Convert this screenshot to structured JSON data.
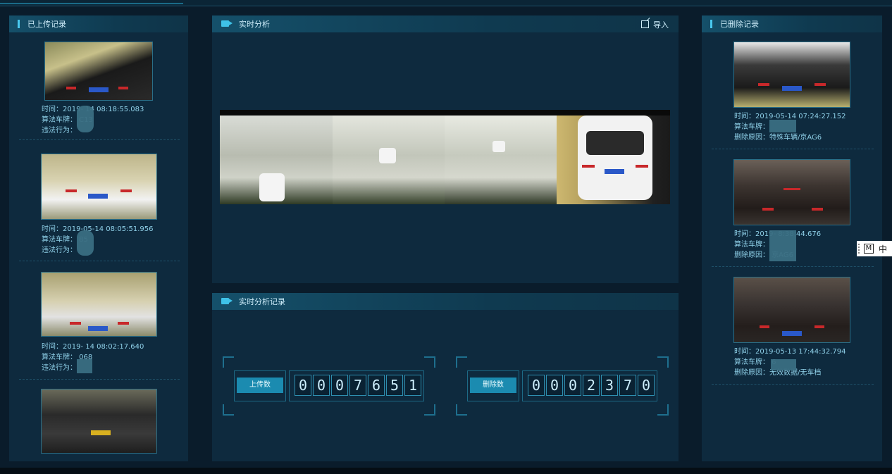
{
  "left_panel": {
    "title": "已上传记录",
    "records": [
      {
        "time": "时间：2019-  14 08:18:55.083",
        "plate": "算法车牌：  C13",
        "violation": "违法行为："
      },
      {
        "time": "时间：2019-05-14 08:05:51.956",
        "plate": "算法车牌：  85",
        "violation": "违法行为："
      },
      {
        "time": "时间：2019-  14 08:02:17.640",
        "plate": "算法车牌：  068",
        "violation": "违法行为："
      }
    ]
  },
  "center_top": {
    "title": "实时分析",
    "import_label": "导入"
  },
  "center_bottom": {
    "title": "实时分析记录",
    "upload_label": "上传数",
    "upload_digits": [
      "0",
      "0",
      "0",
      "7",
      "6",
      "5",
      "1"
    ],
    "delete_label": "删除数",
    "delete_digits": [
      "0",
      "0",
      "0",
      "2",
      "3",
      "7",
      "0"
    ]
  },
  "right_panel": {
    "title": "已删除记录",
    "records": [
      {
        "time": "时间：2019-05-14 07:24:27.152",
        "plate": "算法车牌：",
        "reason": "删除原因：特殊车辆/京AG6"
      },
      {
        "time": "时间：2019-  8:38:44.676",
        "plate": "算法车牌：",
        "reason": "删除原因：  京AG6"
      },
      {
        "time": "时间：2019-05-13 17:44:32.794",
        "plate": "算法车牌：  6",
        "reason": "删除原因：无效数据/无车档"
      }
    ]
  },
  "ime": {
    "mode": "M",
    "lang": "中"
  }
}
